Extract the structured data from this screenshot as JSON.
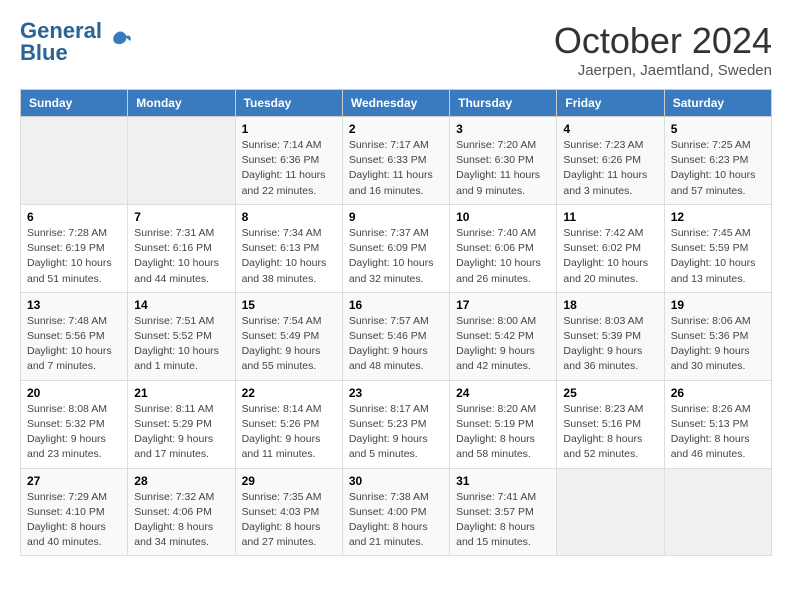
{
  "logo": {
    "part1": "General",
    "part2": "Blue"
  },
  "title": "October 2024",
  "subtitle": "Jaerpen, Jaemtland, Sweden",
  "columns": [
    "Sunday",
    "Monday",
    "Tuesday",
    "Wednesday",
    "Thursday",
    "Friday",
    "Saturday"
  ],
  "weeks": [
    [
      {
        "day": "",
        "info": ""
      },
      {
        "day": "",
        "info": ""
      },
      {
        "day": "1",
        "info": "Sunrise: 7:14 AM\nSunset: 6:36 PM\nDaylight: 11 hours and 22 minutes."
      },
      {
        "day": "2",
        "info": "Sunrise: 7:17 AM\nSunset: 6:33 PM\nDaylight: 11 hours and 16 minutes."
      },
      {
        "day": "3",
        "info": "Sunrise: 7:20 AM\nSunset: 6:30 PM\nDaylight: 11 hours and 9 minutes."
      },
      {
        "day": "4",
        "info": "Sunrise: 7:23 AM\nSunset: 6:26 PM\nDaylight: 11 hours and 3 minutes."
      },
      {
        "day": "5",
        "info": "Sunrise: 7:25 AM\nSunset: 6:23 PM\nDaylight: 10 hours and 57 minutes."
      }
    ],
    [
      {
        "day": "6",
        "info": "Sunrise: 7:28 AM\nSunset: 6:19 PM\nDaylight: 10 hours and 51 minutes."
      },
      {
        "day": "7",
        "info": "Sunrise: 7:31 AM\nSunset: 6:16 PM\nDaylight: 10 hours and 44 minutes."
      },
      {
        "day": "8",
        "info": "Sunrise: 7:34 AM\nSunset: 6:13 PM\nDaylight: 10 hours and 38 minutes."
      },
      {
        "day": "9",
        "info": "Sunrise: 7:37 AM\nSunset: 6:09 PM\nDaylight: 10 hours and 32 minutes."
      },
      {
        "day": "10",
        "info": "Sunrise: 7:40 AM\nSunset: 6:06 PM\nDaylight: 10 hours and 26 minutes."
      },
      {
        "day": "11",
        "info": "Sunrise: 7:42 AM\nSunset: 6:02 PM\nDaylight: 10 hours and 20 minutes."
      },
      {
        "day": "12",
        "info": "Sunrise: 7:45 AM\nSunset: 5:59 PM\nDaylight: 10 hours and 13 minutes."
      }
    ],
    [
      {
        "day": "13",
        "info": "Sunrise: 7:48 AM\nSunset: 5:56 PM\nDaylight: 10 hours and 7 minutes."
      },
      {
        "day": "14",
        "info": "Sunrise: 7:51 AM\nSunset: 5:52 PM\nDaylight: 10 hours and 1 minute."
      },
      {
        "day": "15",
        "info": "Sunrise: 7:54 AM\nSunset: 5:49 PM\nDaylight: 9 hours and 55 minutes."
      },
      {
        "day": "16",
        "info": "Sunrise: 7:57 AM\nSunset: 5:46 PM\nDaylight: 9 hours and 48 minutes."
      },
      {
        "day": "17",
        "info": "Sunrise: 8:00 AM\nSunset: 5:42 PM\nDaylight: 9 hours and 42 minutes."
      },
      {
        "day": "18",
        "info": "Sunrise: 8:03 AM\nSunset: 5:39 PM\nDaylight: 9 hours and 36 minutes."
      },
      {
        "day": "19",
        "info": "Sunrise: 8:06 AM\nSunset: 5:36 PM\nDaylight: 9 hours and 30 minutes."
      }
    ],
    [
      {
        "day": "20",
        "info": "Sunrise: 8:08 AM\nSunset: 5:32 PM\nDaylight: 9 hours and 23 minutes."
      },
      {
        "day": "21",
        "info": "Sunrise: 8:11 AM\nSunset: 5:29 PM\nDaylight: 9 hours and 17 minutes."
      },
      {
        "day": "22",
        "info": "Sunrise: 8:14 AM\nSunset: 5:26 PM\nDaylight: 9 hours and 11 minutes."
      },
      {
        "day": "23",
        "info": "Sunrise: 8:17 AM\nSunset: 5:23 PM\nDaylight: 9 hours and 5 minutes."
      },
      {
        "day": "24",
        "info": "Sunrise: 8:20 AM\nSunset: 5:19 PM\nDaylight: 8 hours and 58 minutes."
      },
      {
        "day": "25",
        "info": "Sunrise: 8:23 AM\nSunset: 5:16 PM\nDaylight: 8 hours and 52 minutes."
      },
      {
        "day": "26",
        "info": "Sunrise: 8:26 AM\nSunset: 5:13 PM\nDaylight: 8 hours and 46 minutes."
      }
    ],
    [
      {
        "day": "27",
        "info": "Sunrise: 7:29 AM\nSunset: 4:10 PM\nDaylight: 8 hours and 40 minutes."
      },
      {
        "day": "28",
        "info": "Sunrise: 7:32 AM\nSunset: 4:06 PM\nDaylight: 8 hours and 34 minutes."
      },
      {
        "day": "29",
        "info": "Sunrise: 7:35 AM\nSunset: 4:03 PM\nDaylight: 8 hours and 27 minutes."
      },
      {
        "day": "30",
        "info": "Sunrise: 7:38 AM\nSunset: 4:00 PM\nDaylight: 8 hours and 21 minutes."
      },
      {
        "day": "31",
        "info": "Sunrise: 7:41 AM\nSunset: 3:57 PM\nDaylight: 8 hours and 15 minutes."
      },
      {
        "day": "",
        "info": ""
      },
      {
        "day": "",
        "info": ""
      }
    ]
  ]
}
